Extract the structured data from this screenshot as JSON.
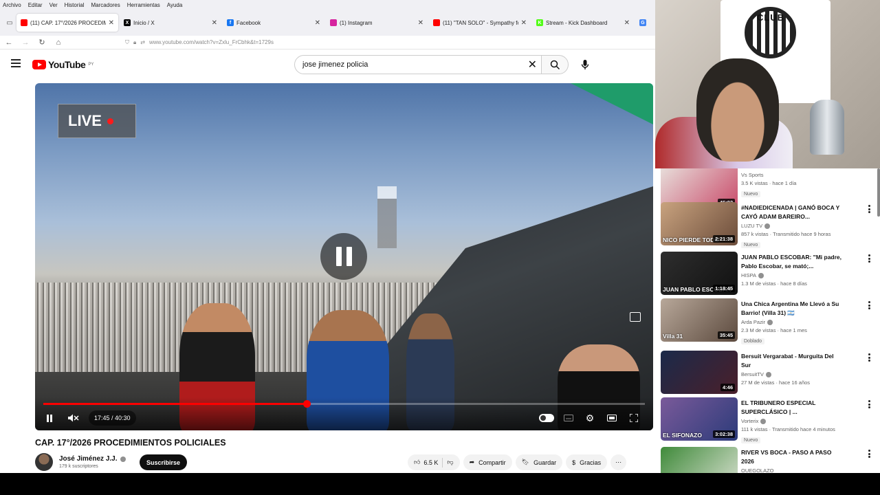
{
  "menubar": [
    "Archivo",
    "Editar",
    "Ver",
    "Historial",
    "Marcadores",
    "Herramientas",
    "Ayuda"
  ],
  "tabs": [
    {
      "label": "(11) CAP. 17°/2026 PROCEDIMI",
      "color": "#ff0000",
      "glyph": "",
      "active": true
    },
    {
      "label": "Inicio / X",
      "color": "#000000",
      "glyph": "X",
      "active": false
    },
    {
      "label": "Facebook",
      "color": "#1877f2",
      "glyph": "f",
      "active": false
    },
    {
      "label": "(1) Instagram",
      "color": "#d6249f",
      "glyph": "",
      "active": false
    },
    {
      "label": "(11) \"TAN SOLO\" - Sympathy fo",
      "color": "#ff0000",
      "glyph": "",
      "active": false
    },
    {
      "label": "Stream - Kick Dashboard",
      "color": "#53fc18",
      "glyph": "K",
      "active": false
    },
    {
      "label": "G",
      "color": "#4285f4",
      "glyph": "G",
      "active": false
    }
  ],
  "url": "www.youtube.com/watch?v=Zxlu_FrCbhk&t=1729s",
  "youtube": {
    "logo_text": "YouTube",
    "region": "PY",
    "search_value": "jose jimenez policia"
  },
  "player": {
    "live_label": "LIVE",
    "time": "17:45 / 40:30",
    "progress": 0.438
  },
  "video": {
    "title": "CAP. 17°/2026 PROCEDIMIENTOS POLICIALES",
    "channel": "José Jiménez  J.J.",
    "subscribers": "179 k suscriptores",
    "subscribe_label": "Suscribirse",
    "likes": "6.5 K",
    "share_label": "Compartir",
    "save_label": "Guardar",
    "thanks_label": "Gracias"
  },
  "recommendations": [
    {
      "title": "",
      "channel": "Vs Sports",
      "meta": "3.5 K vistas · hace 1 día",
      "badge": "Nuevo",
      "duration": "46:02",
      "overlay": "",
      "verified": false,
      "thumb": [
        "#e8e0dc",
        "#c94b6a"
      ]
    },
    {
      "title": "#NADIEDICENADA | GANÓ BOCA Y CAYÓ ADAM BAREIRO...",
      "channel": "LUZU TV",
      "meta": "857 k vistas · Transmitido hace 9 horas",
      "badge": "Nuevo",
      "duration": "2:21:38",
      "overlay": "NICO PIERDE TODO",
      "verified": true,
      "thumb": [
        "#c9a37f",
        "#6b4c3a"
      ]
    },
    {
      "title": "JUAN PABLO ESCOBAR: \"Mi padre, Pablo Escobar, se mató;...",
      "channel": "HISPA",
      "meta": "1.3 M de vistas · hace 8 días",
      "badge": "",
      "duration": "1:18:45",
      "overlay": "JUAN PABLO ESCOBAR",
      "verified": true,
      "thumb": [
        "#2e2e2e",
        "#111"
      ]
    },
    {
      "title": "Una Chica Argentina Me Llevó a Su Barrio! (Villa 31) 🇦🇷",
      "channel": "Arda Pazir",
      "meta": "2.3 M de vistas · hace 1 mes",
      "badge": "Doblado",
      "duration": "35:45",
      "overlay": "Villa 31",
      "verified": true,
      "thumb": [
        "#b8a89a",
        "#5c4a3e"
      ]
    },
    {
      "title": "Bersuit Vergarabat - Murguita Del Sur",
      "channel": "BersuitTV",
      "meta": "27 M de vistas · hace 16 años",
      "badge": "",
      "duration": "4:46",
      "overlay": "",
      "verified": true,
      "thumb": [
        "#1b2a4a",
        "#4a1f2a"
      ]
    },
    {
      "title": "EL TRIBUNERO ESPECIAL SUPERCLÁSICO | ...",
      "channel": "Vorterix",
      "meta": "111 k vistas · Transmitido hace 4 minutos",
      "badge": "Nuevo",
      "duration": "3:02:38",
      "overlay": "EL SIFONAZO",
      "verified": true,
      "thumb": [
        "#7a5a9a",
        "#2c3b7a"
      ]
    },
    {
      "title": "RIVER VS BOCA - PASO A PASO 2026",
      "channel": "OUEGOLAZO",
      "meta": "",
      "badge": "",
      "duration": "",
      "overlay": "",
      "verified": false,
      "thumb": [
        "#3f8a3a",
        "#d8e0d0"
      ]
    }
  ],
  "webcam": {
    "crest_text": "CLUB"
  }
}
